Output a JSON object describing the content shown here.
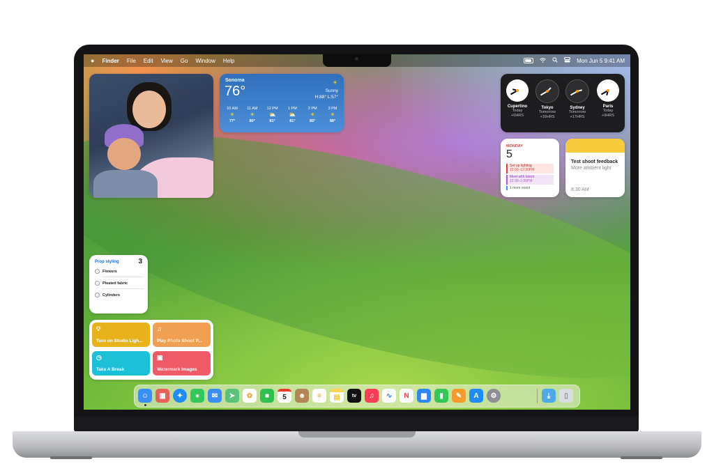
{
  "menubar": {
    "apple_icon": "apple-icon",
    "app_name": "Finder",
    "menus": [
      "File",
      "Edit",
      "View",
      "Go",
      "Window",
      "Help"
    ],
    "status_icons": [
      "battery-icon",
      "wifi-icon",
      "search-icon",
      "control-center-icon"
    ],
    "datetime": "Mon Jun 5  9:41 AM"
  },
  "weather": {
    "city": "Sonoma",
    "temperature": "76°",
    "condition": "Sunny",
    "high_low": "H:88° L:57°",
    "hourly": [
      {
        "time": "10 AM",
        "icon": "sun-icon",
        "temp": "77°"
      },
      {
        "time": "11 AM",
        "icon": "sun-icon",
        "temp": "80°"
      },
      {
        "time": "12 PM",
        "icon": "partly-cloudy-icon",
        "temp": "81°"
      },
      {
        "time": "1 PM",
        "icon": "partly-cloudy-icon",
        "temp": "81°"
      },
      {
        "time": "2 PM",
        "icon": "sun-icon",
        "temp": "85°"
      },
      {
        "time": "3 PM",
        "icon": "sun-icon",
        "temp": "88°"
      }
    ]
  },
  "clocks": [
    {
      "city": "Cupertino",
      "day": "Today",
      "offset": "+0HRS"
    },
    {
      "city": "Tokyo",
      "day": "Tomorrow",
      "offset": "+16HRS"
    },
    {
      "city": "Sydney",
      "day": "Tomorrow",
      "offset": "+17HRS"
    },
    {
      "city": "Paris",
      "day": "Today",
      "offset": "+9HRS"
    }
  ],
  "calendar": {
    "weekday": "MONDAY",
    "date": "5",
    "events": [
      {
        "title": "Set up lighting",
        "time": "12:00–12:30PM",
        "color": "#e53b30"
      },
      {
        "title": "Meet with talent",
        "time": "12:30–1:00PM",
        "color": "#b25ad0"
      }
    ],
    "more": "1 more event"
  },
  "notes": {
    "title": "Test shoot feedback",
    "body": "More ambient light",
    "time": "8:30 AM"
  },
  "reminders": {
    "list_name": "Prop styling",
    "count": "3",
    "items": [
      "Flowers",
      "Pleated fabric",
      "Cylinders"
    ]
  },
  "shortcuts": [
    {
      "label": "Turn on Studio Ligh...",
      "icon": "lightbulb-icon",
      "color": "#e8b21a"
    },
    {
      "label": "Play Photo Shoot P...",
      "icon": "music-note-icon",
      "color": "#f0a050"
    },
    {
      "label": "Take A Break",
      "icon": "timer-icon",
      "color": "#1cc0d8"
    },
    {
      "label": "Watermark Images",
      "icon": "photo-icon",
      "color": "#ef5a66"
    }
  ],
  "dock": [
    {
      "name": "finder",
      "glyph": "☺",
      "color": "#3a8ef7"
    },
    {
      "name": "launchpad",
      "glyph": "▦",
      "color": "#e8605a"
    },
    {
      "name": "safari",
      "glyph": "✦",
      "color": "#1e8cf0"
    },
    {
      "name": "messages",
      "glyph": "●",
      "color": "#34c759"
    },
    {
      "name": "mail",
      "glyph": "✉",
      "color": "#3b8df5"
    },
    {
      "name": "maps",
      "glyph": "➤",
      "color": "#5ac27a"
    },
    {
      "name": "photos",
      "glyph": "✿",
      "color": "#f2a33c"
    },
    {
      "name": "facetime",
      "glyph": "■",
      "color": "#30c050"
    },
    {
      "name": "calendar",
      "glyph": "5",
      "color": "#ffffff"
    },
    {
      "name": "contacts",
      "glyph": "☻",
      "color": "#b48657"
    },
    {
      "name": "reminders",
      "glyph": "≡",
      "color": "#ffffff"
    },
    {
      "name": "notes",
      "glyph": "▤",
      "color": "#f7d45a"
    },
    {
      "name": "apple-tv",
      "glyph": "tv",
      "color": "#111111"
    },
    {
      "name": "music",
      "glyph": "♫",
      "color": "#fa3d57"
    },
    {
      "name": "freeform",
      "glyph": "∿",
      "color": "#ffffff"
    },
    {
      "name": "news",
      "glyph": "N",
      "color": "#f5374c"
    },
    {
      "name": "keynote",
      "glyph": "▆",
      "color": "#2f86f5"
    },
    {
      "name": "numbers",
      "glyph": "▮",
      "color": "#34c759"
    },
    {
      "name": "pages",
      "glyph": "✎",
      "color": "#f59a2b"
    },
    {
      "name": "app-store",
      "glyph": "A",
      "color": "#1d8cf5"
    },
    {
      "name": "system-settings",
      "glyph": "⚙",
      "color": "#8e8e93"
    },
    {
      "name": "downloads-folder",
      "glyph": "⤓",
      "color": "#4fa8e8"
    },
    {
      "name": "trash",
      "glyph": "▯",
      "color": "#d9dde0"
    }
  ]
}
